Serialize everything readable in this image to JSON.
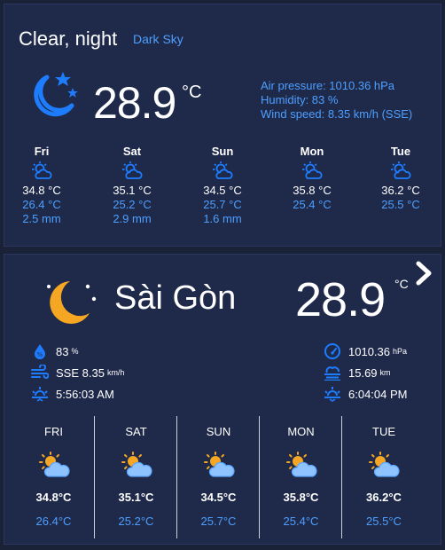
{
  "current": {
    "condition": "Clear, night",
    "provider": "Dark Sky",
    "temperature": "28.9",
    "unit": "°C",
    "air_pressure": "Air pressure: 1010.36 hPa",
    "humidity": "Humidity: 83 %",
    "wind_speed": "Wind speed: 8.35 km/h (SSE)"
  },
  "forecast_small": [
    {
      "day": "Fri",
      "high": "34.8 °C",
      "low": "26.4 °C",
      "rain": "2.5 mm"
    },
    {
      "day": "Sat",
      "high": "35.1 °C",
      "low": "25.2 °C",
      "rain": "2.9 mm"
    },
    {
      "day": "Sun",
      "high": "34.5 °C",
      "low": "25.7 °C",
      "rain": "1.6 mm"
    },
    {
      "day": "Mon",
      "high": "35.8 °C",
      "low": "25.4 °C",
      "rain": ""
    },
    {
      "day": "Tue",
      "high": "36.2 °C",
      "low": "25.5 °C",
      "rain": ""
    }
  ],
  "city_card": {
    "city": "Sài Gòn",
    "temperature": "28.9",
    "unit": "°C",
    "humidity_value": "83",
    "humidity_unit": "%",
    "wind_value": "SSE 8.35",
    "wind_unit": "km/h",
    "sunrise": "5:56:03 AM",
    "pressure_value": "1010.36",
    "pressure_unit": "hPa",
    "visibility_value": "15.69",
    "visibility_unit": "km",
    "sunset": "6:04:04 PM"
  },
  "forecast_large": [
    {
      "day": "FRI",
      "high": "34.8°C",
      "low": "26.4°C"
    },
    {
      "day": "SAT",
      "high": "35.1°C",
      "low": "25.2°C"
    },
    {
      "day": "SUN",
      "high": "34.5°C",
      "low": "25.7°C"
    },
    {
      "day": "MON",
      "high": "35.8°C",
      "low": "25.4°C"
    },
    {
      "day": "TUE",
      "high": "36.2°C",
      "low": "25.5°C"
    }
  ],
  "colors": {
    "background": "#1a2238",
    "card": "#1f2a4a",
    "accent_blue": "#4d9fff",
    "moon_blue": "#1e7cff",
    "moon_orange": "#f5a623",
    "sun_yellow": "#f5a623",
    "cloud_blue": "#8fc3ff"
  },
  "icons": {
    "current": "moon-stars-icon",
    "forecast": "partly-cloudy-icon",
    "city": "moon-icon",
    "next": "chevron-right-icon",
    "humidity": "humidity-drop-icon",
    "wind": "wind-icon",
    "sunrise": "sunrise-icon",
    "pressure": "gauge-icon",
    "visibility": "fog-icon",
    "sunset": "sunset-icon"
  }
}
